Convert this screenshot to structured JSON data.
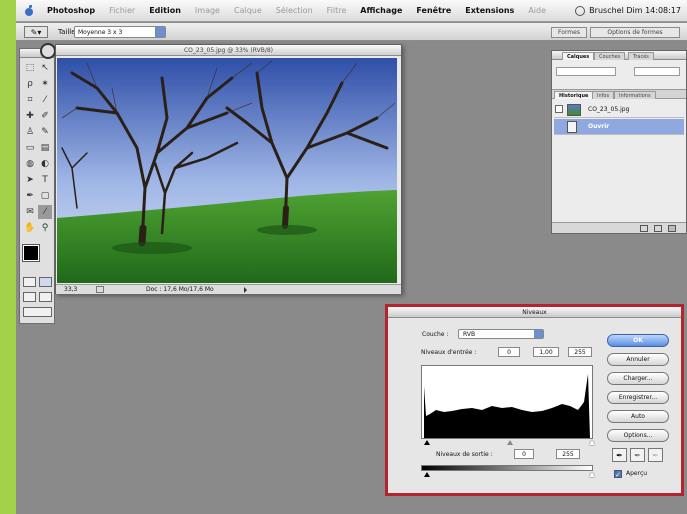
{
  "menubar": {
    "app": "Photoshop",
    "items": [
      {
        "label": "Fichier",
        "dim": true
      },
      {
        "label": "Edition",
        "dim": false
      },
      {
        "label": "Image",
        "dim": true
      },
      {
        "label": "Calque",
        "dim": true
      },
      {
        "label": "Sélection",
        "dim": true
      },
      {
        "label": "Filtre",
        "dim": true
      },
      {
        "label": "Affichage",
        "dim": false
      },
      {
        "label": "Fenêtre",
        "dim": false
      },
      {
        "label": "Extensions",
        "dim": false
      },
      {
        "label": "Aide",
        "dim": true
      }
    ],
    "clock": "Bruschel  Dim 14:08:17"
  },
  "options": {
    "label": "Taille :",
    "preset": "Moyenne 3 x 3",
    "right_buttons": [
      "Formes",
      "Options de formes"
    ]
  },
  "document": {
    "title": "CO_23_05.jpg @ 33% (RVB/8)",
    "zoom": "33,3",
    "status": "Doc : 17,6 Mo/17,6 Mo"
  },
  "palette": {
    "tabs_top": [
      "Calques",
      "Couches",
      "Tracés"
    ],
    "tabs": [
      "Historique",
      "Infos",
      "Informations"
    ],
    "rows": [
      {
        "name": "CO_23_05.jpg"
      },
      {
        "name": "Ouvrir"
      }
    ]
  },
  "levels": {
    "title": "Niveaux",
    "channel_label": "Couche :",
    "channel_value": "RVB",
    "input_label": "Niveaux d'entrée :",
    "input_values": [
      "0",
      "1,00",
      "255"
    ],
    "output_label": "Niveaux de sortie :",
    "output_values": [
      "0",
      "255"
    ],
    "buttons": [
      "OK",
      "Annuler",
      "Charger...",
      "Enregistrer...",
      "Auto",
      "Options..."
    ],
    "preview_label": "Aperçu",
    "preview_checked": true
  },
  "colors": {
    "accent": "#b3242c",
    "screen": "#8a8a8a",
    "frame": "#a3d14a"
  }
}
